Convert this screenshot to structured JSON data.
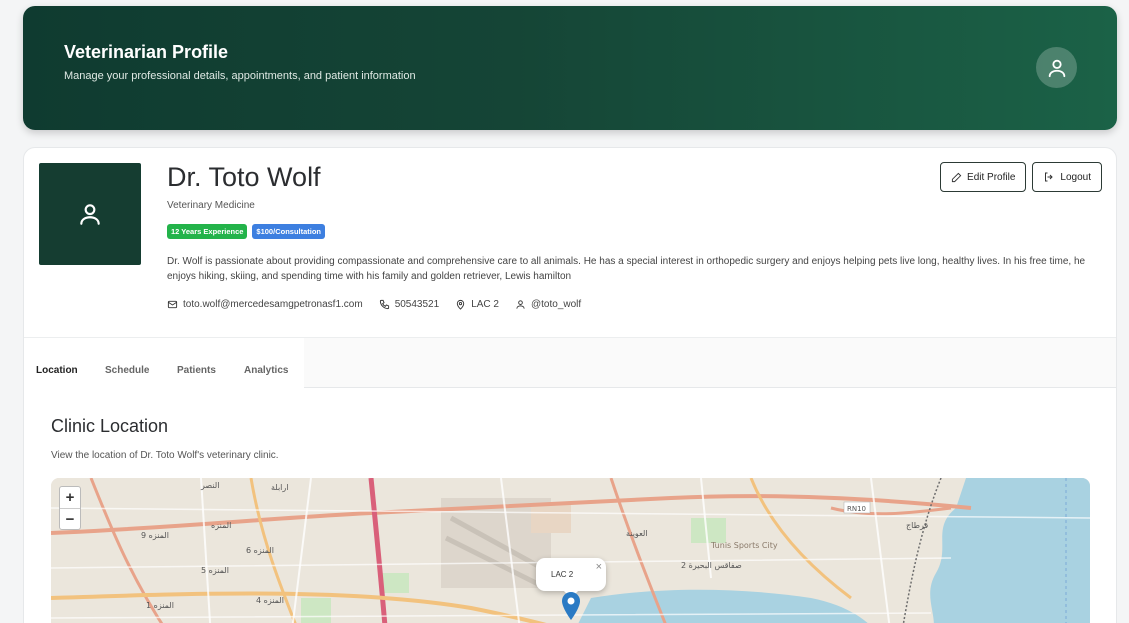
{
  "header": {
    "title": "Veterinarian Profile",
    "subtitle": "Manage your professional details, appointments, and patient information",
    "avatar_icon": "user-icon"
  },
  "profile": {
    "name": "Dr. Toto Wolf",
    "specialty": "Veterinary Medicine",
    "badges": [
      "12 Years Experience",
      "$100/Consultation"
    ],
    "bio": "Dr. Wolf is passionate about providing compassionate and comprehensive care to all animals. He has a special interest in orthopedic surgery and enjoys helping pets live long, healthy lives. In his free time, he enjoys hiking, skiing, and spending time with his family and golden retriever, Lewis hamilton",
    "email": "toto.wolf@mercedesamgpetronasf1.com",
    "phone": "50543521",
    "location": "LAC 2",
    "handle": "@toto_wolf"
  },
  "actions": {
    "edit_label": "Edit Profile",
    "logout_label": "Logout"
  },
  "tabs": [
    "Location",
    "Schedule",
    "Patients",
    "Analytics"
  ],
  "active_tab": "Location",
  "section": {
    "title": "Clinic Location",
    "subtitle": "View the location of Dr. Toto Wolf's veterinary clinic."
  },
  "map": {
    "zoom_in": "+",
    "zoom_out": "−",
    "popup_label": "LAC 2",
    "popup_close": "×",
    "labels": [
      "ارابلة",
      "النصر",
      "المنزه",
      "المنزه 9",
      "المنزه 6",
      "المنزه 5",
      "المنزه 4",
      "المنزه 1",
      "العوينة",
      "صفاقس البحيرة 2",
      "Tunis Sports City",
      "RN10",
      "قرطاج"
    ]
  },
  "colors": {
    "hero_start": "#0f3b30",
    "hero_end": "#1b6247",
    "badge_green": "#23b34a",
    "badge_blue": "#3d7fe0",
    "marker": "#2a7ac4"
  }
}
